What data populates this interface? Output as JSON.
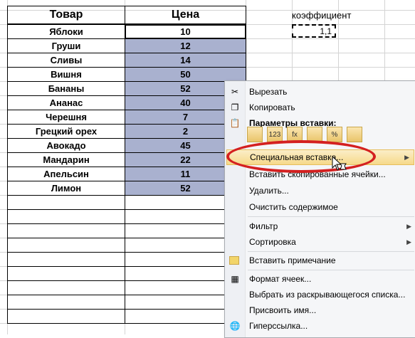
{
  "table": {
    "headers": {
      "product": "Товар",
      "price": "Цена"
    },
    "rows": [
      {
        "product": "Яблоки",
        "price": "10"
      },
      {
        "product": "Груши",
        "price": "12"
      },
      {
        "product": "Сливы",
        "price": "14"
      },
      {
        "product": "Вишня",
        "price": "50"
      },
      {
        "product": "Бананы",
        "price": "52"
      },
      {
        "product": "Ананас",
        "price": "40"
      },
      {
        "product": "Черешня",
        "price": "7"
      },
      {
        "product": "Грецкий орех",
        "price": "2"
      },
      {
        "product": "Авокадо",
        "price": "45"
      },
      {
        "product": "Мандарин",
        "price": "22"
      },
      {
        "product": "Апельсин",
        "price": "11"
      },
      {
        "product": "Лимон",
        "price": "52"
      }
    ]
  },
  "coefficient": {
    "label": "коэффициент",
    "value": "1,1"
  },
  "menu": {
    "items": [
      {
        "label": "Вырезать",
        "icon": "scissors-icon"
      },
      {
        "label": "Копировать",
        "icon": "copy-icon"
      },
      {
        "label": "Параметры вставки:",
        "icon": "clipboard-icon"
      },
      {
        "label": "Специальная вставка...",
        "icon": ""
      },
      {
        "label": "Вставить скопированные ячейки...",
        "icon": ""
      },
      {
        "label": "Удалить...",
        "icon": ""
      },
      {
        "label": "Очистить содержимое",
        "icon": ""
      },
      {
        "label": "Фильтр",
        "icon": ""
      },
      {
        "label": "Сортировка",
        "icon": ""
      },
      {
        "label": "Вставить примечание",
        "icon": "comment-icon"
      },
      {
        "label": "Формат ячеек...",
        "icon": "format-cells-icon"
      },
      {
        "label": "Выбрать из раскрывающегося списка...",
        "icon": ""
      },
      {
        "label": "Присвоить имя...",
        "icon": ""
      },
      {
        "label": "Гиперссылка...",
        "icon": "hyperlink-icon"
      }
    ],
    "paste_options": [
      "paste-icon",
      "paste-values-icon",
      "paste-formulas-icon",
      "paste-transpose-icon",
      "paste-formatting-icon",
      "paste-link-icon"
    ],
    "paste_labels": [
      "",
      "123",
      "fx",
      "",
      "%",
      ""
    ]
  },
  "colors": {
    "selection": "#a9b1cf",
    "highlight_ring": "#d42020"
  }
}
